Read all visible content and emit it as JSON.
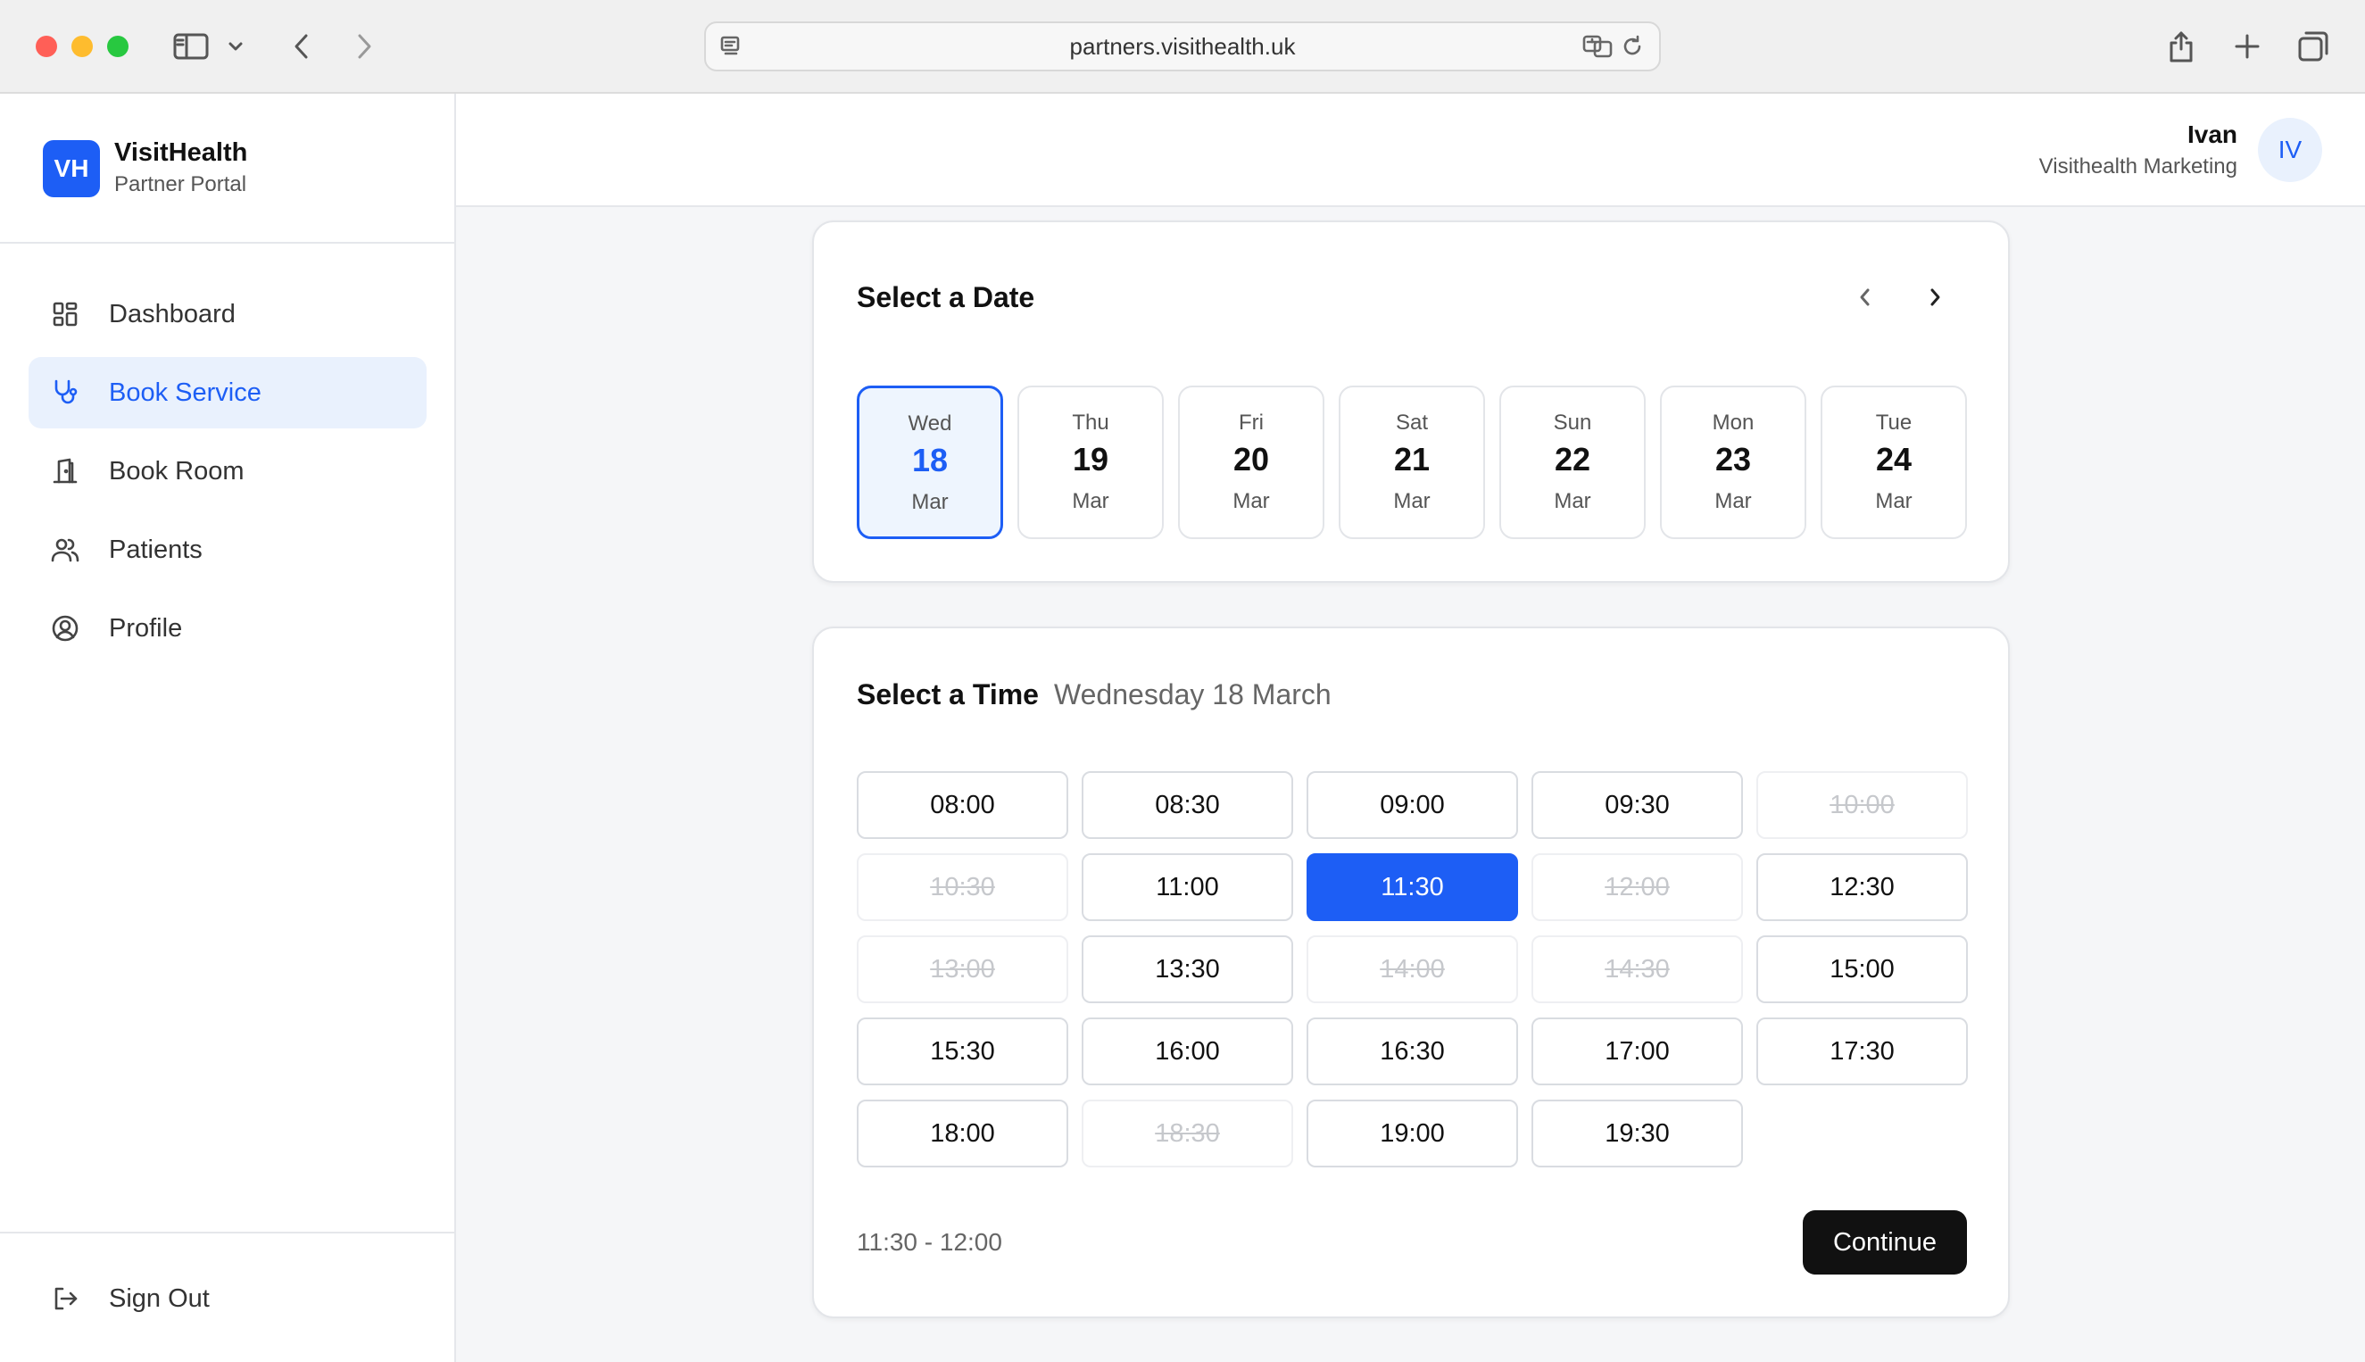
{
  "browser": {
    "url": "partners.visithealth.uk"
  },
  "brand": {
    "logo_text": "VH",
    "name": "VisitHealth",
    "subtitle": "Partner Portal",
    "accent_color": "#1d5ef5"
  },
  "sidebar": {
    "items": [
      {
        "label": "Dashboard",
        "icon": "grid-icon",
        "active": false
      },
      {
        "label": "Book Service",
        "icon": "stethoscope-icon",
        "active": true
      },
      {
        "label": "Book Room",
        "icon": "door-icon",
        "active": false
      },
      {
        "label": "Patients",
        "icon": "users-icon",
        "active": false
      },
      {
        "label": "Profile",
        "icon": "user-circle-icon",
        "active": false
      }
    ],
    "sign_out": {
      "label": "Sign Out",
      "icon": "logout-icon"
    }
  },
  "header": {
    "user_name": "Ivan",
    "user_org": "Visithealth Marketing",
    "avatar_initials": "IV"
  },
  "date_picker": {
    "title": "Select a Date",
    "days": [
      {
        "dow": "Wed",
        "num": "18",
        "mon": "Mar",
        "selected": true
      },
      {
        "dow": "Thu",
        "num": "19",
        "mon": "Mar",
        "selected": false
      },
      {
        "dow": "Fri",
        "num": "20",
        "mon": "Mar",
        "selected": false
      },
      {
        "dow": "Sat",
        "num": "21",
        "mon": "Mar",
        "selected": false
      },
      {
        "dow": "Sun",
        "num": "22",
        "mon": "Mar",
        "selected": false
      },
      {
        "dow": "Mon",
        "num": "23",
        "mon": "Mar",
        "selected": false
      },
      {
        "dow": "Tue",
        "num": "24",
        "mon": "Mar",
        "selected": false
      }
    ]
  },
  "time_picker": {
    "title": "Select a Time",
    "subtitle": "Wednesday 18 March",
    "slots": [
      {
        "time": "08:00",
        "state": "available"
      },
      {
        "time": "08:30",
        "state": "available"
      },
      {
        "time": "09:00",
        "state": "available"
      },
      {
        "time": "09:30",
        "state": "available"
      },
      {
        "time": "10:00",
        "state": "unavailable"
      },
      {
        "time": "10:30",
        "state": "unavailable"
      },
      {
        "time": "11:00",
        "state": "available"
      },
      {
        "time": "11:30",
        "state": "selected"
      },
      {
        "time": "12:00",
        "state": "unavailable"
      },
      {
        "time": "12:30",
        "state": "available"
      },
      {
        "time": "13:00",
        "state": "unavailable"
      },
      {
        "time": "13:30",
        "state": "available"
      },
      {
        "time": "14:00",
        "state": "unavailable"
      },
      {
        "time": "14:30",
        "state": "unavailable"
      },
      {
        "time": "15:00",
        "state": "available"
      },
      {
        "time": "15:30",
        "state": "available"
      },
      {
        "time": "16:00",
        "state": "available"
      },
      {
        "time": "16:30",
        "state": "available"
      },
      {
        "time": "17:00",
        "state": "available"
      },
      {
        "time": "17:30",
        "state": "available"
      },
      {
        "time": "18:00",
        "state": "available"
      },
      {
        "time": "18:30",
        "state": "unavailable"
      },
      {
        "time": "19:00",
        "state": "available"
      },
      {
        "time": "19:30",
        "state": "available"
      }
    ],
    "selected_range": "11:30 - 12:00",
    "continue_label": "Continue"
  }
}
